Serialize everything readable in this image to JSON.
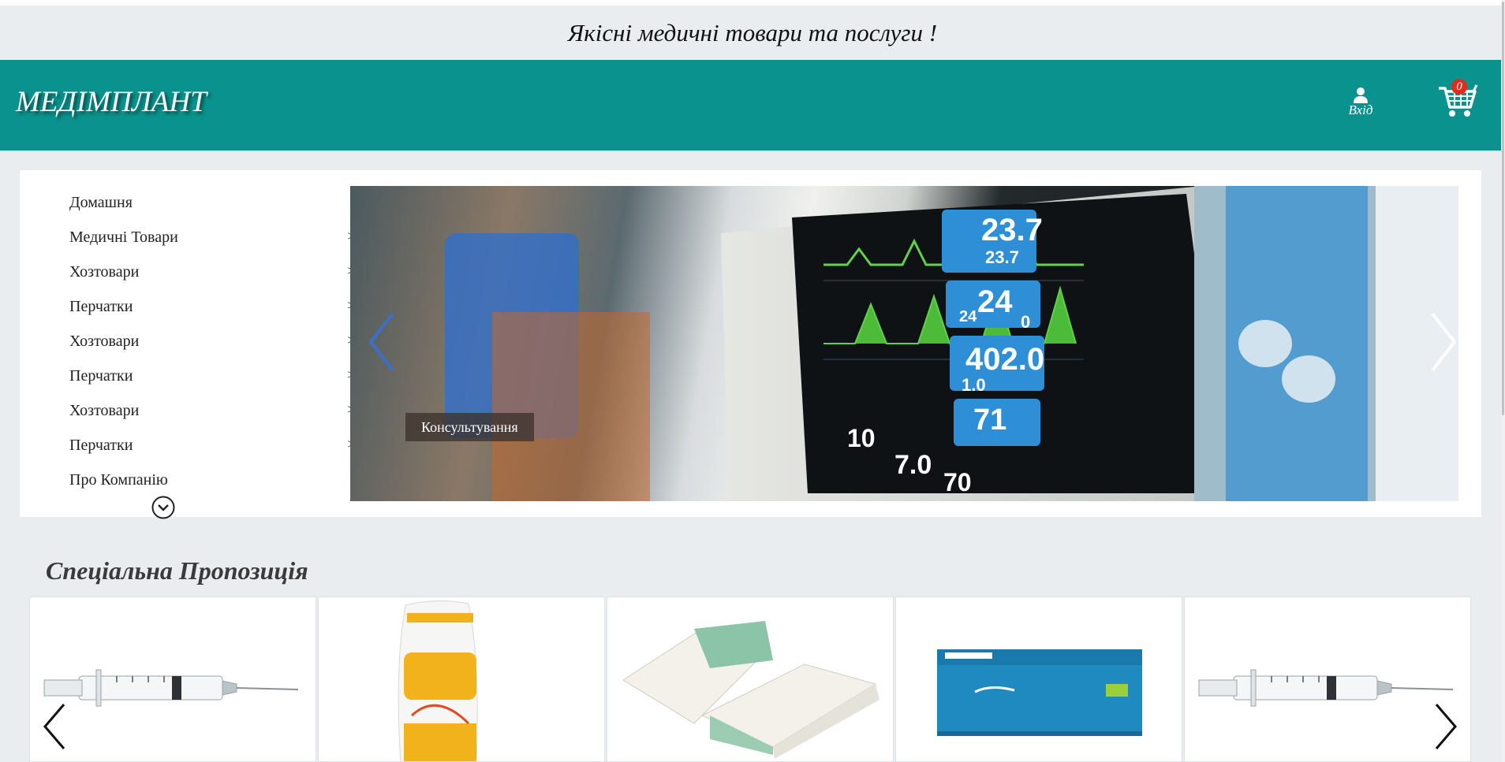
{
  "tagline": "Якісні медичні товари та послуги !",
  "header": {
    "logo": "МЕДІМПЛАНТ",
    "login_label": "Вхід",
    "cart_count": "0"
  },
  "menu": {
    "items": [
      {
        "label": "Домашня",
        "has_submenu": false
      },
      {
        "label": "Медичні Товари",
        "has_submenu": true
      },
      {
        "label": "Хозтовари",
        "has_submenu": true
      },
      {
        "label": "Перчатки",
        "has_submenu": true
      },
      {
        "label": "Хозтовари",
        "has_submenu": true
      },
      {
        "label": "Перчатки",
        "has_submenu": true
      },
      {
        "label": "Хозтовари",
        "has_submenu": true
      },
      {
        "label": "Перчатки",
        "has_submenu": true
      },
      {
        "label": "Про Компанію",
        "has_submenu": false
      }
    ],
    "submenu_arrow": ">"
  },
  "slider": {
    "caption": "Консультування",
    "readouts": [
      "23.7",
      "23.7",
      "24",
      "24",
      "0",
      "402.0",
      "1.0",
      "71",
      "10",
      "7.0",
      "70"
    ]
  },
  "special": {
    "title": "Спеціальна Пропозиція",
    "products": [
      {
        "image": "syringe"
      },
      {
        "image": "cotton-wool-pack"
      },
      {
        "image": "paper-towels"
      },
      {
        "image": "nitrylex-gloves-box"
      },
      {
        "image": "syringe"
      }
    ]
  },
  "colors": {
    "header_bg": "#0a938e",
    "page_bg": "#e9edf0",
    "badge": "#e32b1d"
  }
}
